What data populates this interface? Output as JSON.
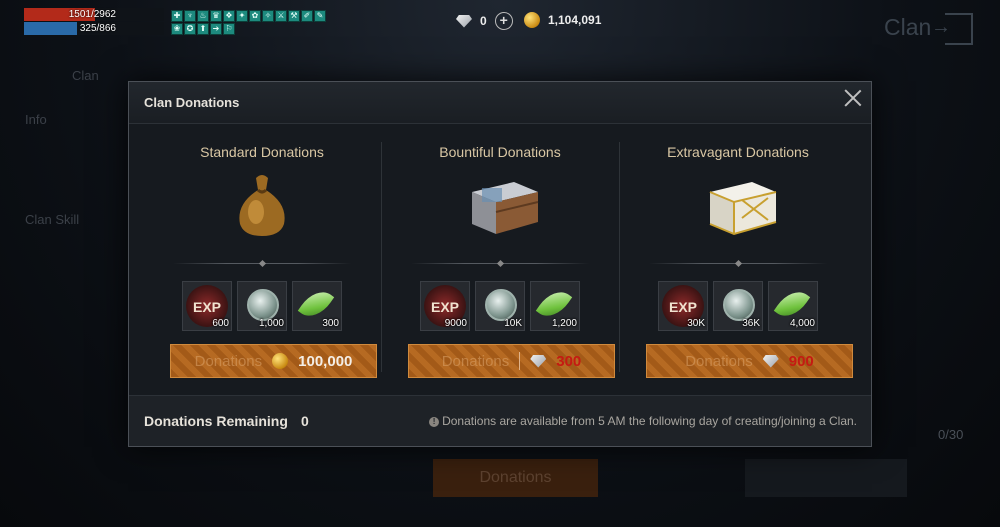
{
  "hud": {
    "hp_text": "1501/2962",
    "hp_ratio": 0.507,
    "mp_text": "325/866",
    "mp_ratio": 0.375,
    "buff_icons": [
      "✚",
      "♆",
      "♨",
      "♛",
      "❖",
      "✦",
      "✿",
      "✧",
      "⚔",
      "⚒",
      "✐",
      "✎",
      "❀",
      "✪",
      "⬆",
      "➔",
      "⚐"
    ]
  },
  "currency": {
    "diamonds": "0",
    "gold": "1,104,091"
  },
  "background": {
    "title": "Clan",
    "tab": "Clan",
    "side_items": [
      "Info",
      "",
      "Clan Skill",
      "",
      "",
      "",
      ""
    ],
    "donate_label": "Donations",
    "count": "0/30"
  },
  "dialog": {
    "title": "Clan Donations",
    "panels": [
      {
        "title": "Standard Donations",
        "items": [
          {
            "icon": "exp-icon",
            "label": "EXP",
            "qty": "600"
          },
          {
            "icon": "silver-coin-icon",
            "qty": "1,000"
          },
          {
            "icon": "green-leaf-icon",
            "qty": "300"
          }
        ],
        "button_label": "Donations",
        "price": "100,000",
        "currency": "gold"
      },
      {
        "title": "Bountiful Donations",
        "items": [
          {
            "icon": "exp-icon",
            "label": "EXP",
            "qty": "9000"
          },
          {
            "icon": "silver-coin-icon",
            "qty": "10K"
          },
          {
            "icon": "green-leaf-icon",
            "qty": "1,200"
          }
        ],
        "button_label": "Donations",
        "price": "300",
        "currency": "diamond"
      },
      {
        "title": "Extravagant Donations",
        "items": [
          {
            "icon": "exp-icon",
            "label": "EXP",
            "qty": "30K"
          },
          {
            "icon": "silver-coin-icon",
            "qty": "36K"
          },
          {
            "icon": "green-leaf-icon",
            "qty": "4,000"
          }
        ],
        "button_label": "Donations",
        "price": "900",
        "currency": "diamond"
      }
    ],
    "remaining_label": "Donations Remaining",
    "remaining_value": "0",
    "notice": "Donations are available from 5 AM the following day of creating/joining a Clan."
  },
  "colors": {
    "accent": "#b66a22",
    "price_red": "#c51a12",
    "title_gold": "#d9c7a4"
  }
}
